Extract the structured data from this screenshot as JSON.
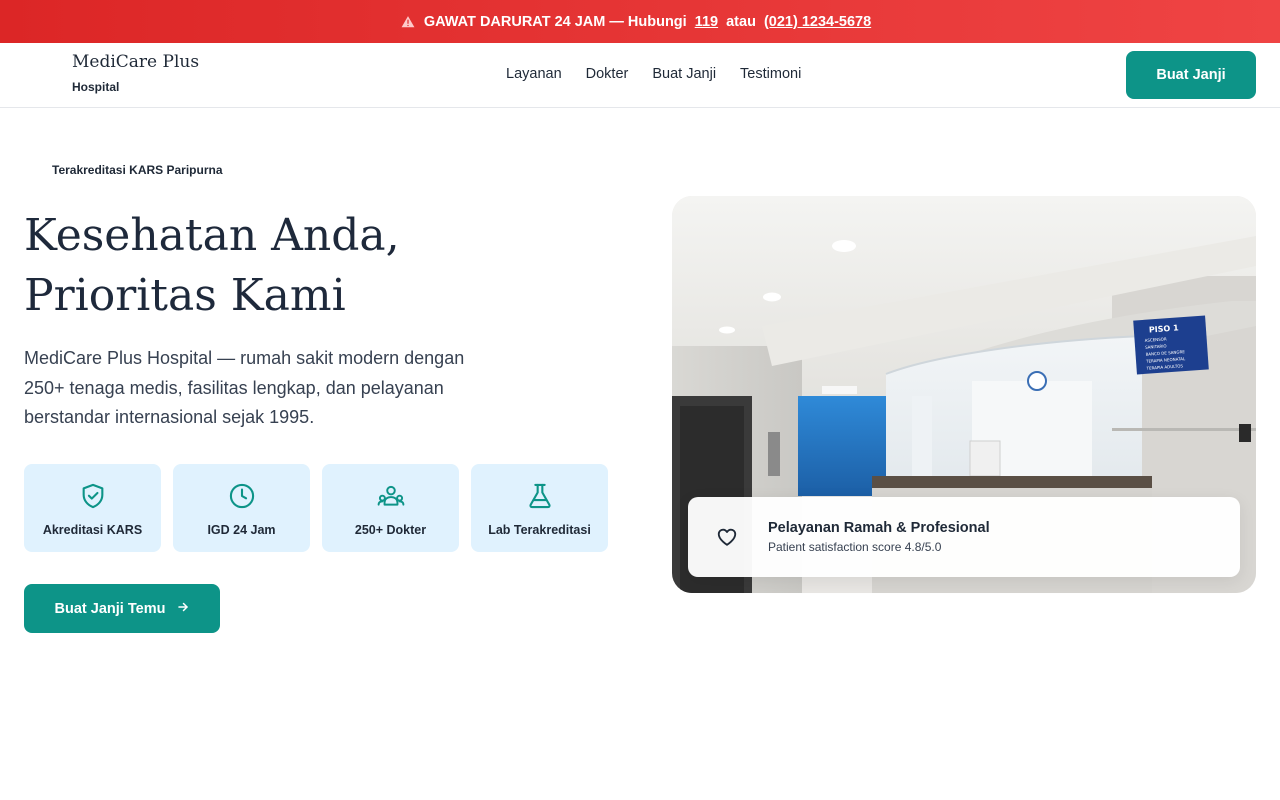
{
  "banner": {
    "icon": "warning-icon",
    "text": "GAWAT DARURAT 24 JAM — Hubungi",
    "phone_short": "119",
    "connector": "atau",
    "phone_long": "(021) 1234-5678"
  },
  "brand": {
    "name": "MediCare Plus",
    "subtitle": "Hospital"
  },
  "nav": {
    "links": [
      "Layanan",
      "Dokter",
      "Buat Janji",
      "Testimoni"
    ],
    "cta_label": "Buat Janji"
  },
  "hero": {
    "badge": "Terakreditasi KARS Paripurna",
    "title_line1": "Kesehatan Anda,",
    "title_line2": "Prioritas Kami",
    "description": "MediCare Plus Hospital — rumah sakit modern dengan 250+ tenaga medis, fasilitas lengkap, dan pelayanan berstandar internasional sejak 1995.",
    "features": [
      {
        "icon": "shield-check-icon",
        "label": "Akreditasi KARS"
      },
      {
        "icon": "clock-icon",
        "label": "IGD 24 Jam"
      },
      {
        "icon": "users-icon",
        "label": "250+ Dokter"
      },
      {
        "icon": "flask-icon",
        "label": "Lab Terakreditasi"
      }
    ],
    "cta_label": "Buat Janji Temu",
    "cta_icon": "arrow-right-icon"
  },
  "image": {
    "sign_title": "PISO 1",
    "sign_lines": [
      "ASCENSOR",
      "SANITARIO",
      "BANCO DE SANGRE",
      "TERAPIA NEONATAL",
      "TERAPIA ADULTOS"
    ]
  },
  "card": {
    "icon": "heart-icon",
    "title": "Pelayanan Ramah & Profesional",
    "subtitle": "Patient satisfaction score 4.8/5.0"
  },
  "colors": {
    "accent": "#0d9488",
    "emergency": "#ef4444",
    "feature_bg": "#e0f2fe"
  }
}
